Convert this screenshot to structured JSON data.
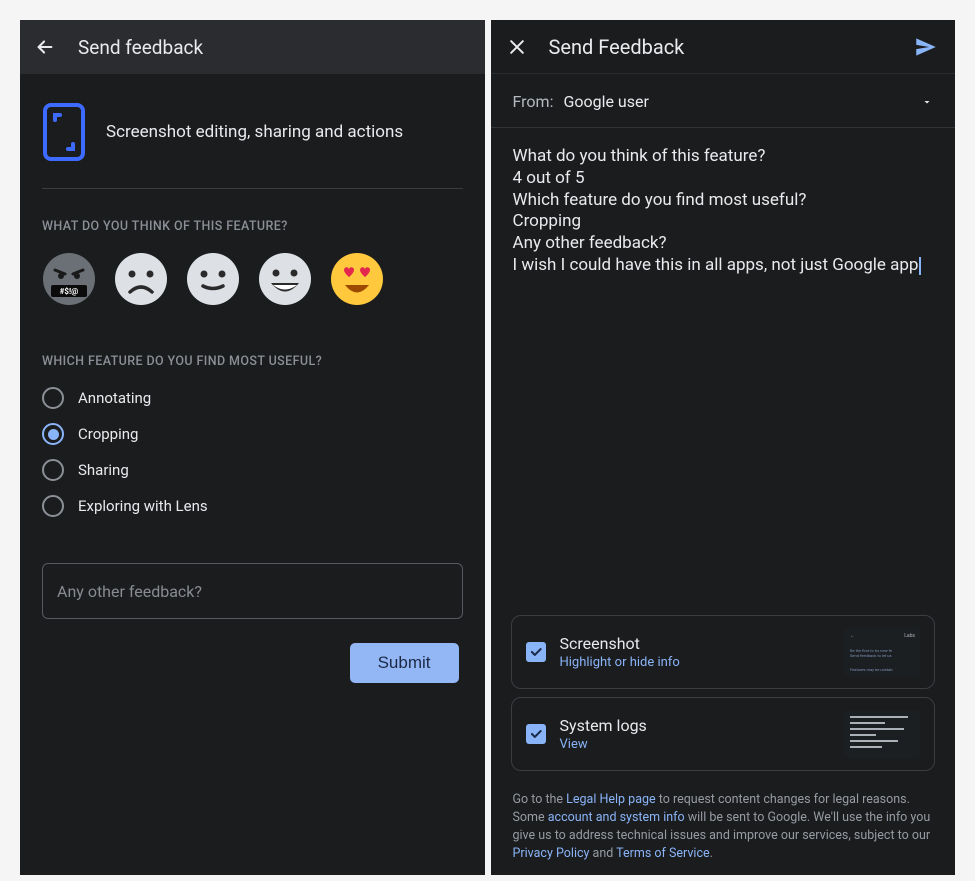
{
  "left": {
    "appbar_title": "Send feedback",
    "feature_title": "Screenshot editing, sharing and actions",
    "q1_label": "WHAT DO YOU THINK OF THIS FEATURE?",
    "q2_label": "WHICH FEATURE DO YOU FIND MOST USEFUL?",
    "options": {
      "0": {
        "label": "Annotating"
      },
      "1": {
        "label": "Cropping"
      },
      "2": {
        "label": "Sharing"
      },
      "3": {
        "label": "Exploring with Lens"
      }
    },
    "selected_option_index": 1,
    "textfield_placeholder": "Any other feedback?",
    "submit_label": "Submit"
  },
  "right": {
    "appbar_title": "Send Feedback",
    "from_label": "From:",
    "from_value": "Google user",
    "message": {
      "l0": "What do you think of this feature?",
      "l1": "4 out of 5",
      "l2": "Which feature do you find most useful?",
      "l3": "Cropping",
      "l4": "Any other feedback?",
      "l5": "I wish I could have this in all apps, not just Google app"
    },
    "attach_screenshot_title": "Screenshot",
    "attach_screenshot_sub": "Highlight or hide info",
    "attach_syslogs_title": "System logs",
    "attach_syslogs_sub": "View",
    "thumb_labs_label": "Labs",
    "legal": {
      "t0": "Go to the ",
      "link0": "Legal Help page",
      "t1": " to request content changes for legal reasons.",
      "t2": "Some ",
      "link1": "account and system info",
      "t3": " will be sent to Google. We'll use the info you give us to address technical issues and improve our services, subject to our ",
      "link2": "Privacy Policy",
      "t4": " and ",
      "link3": "Terms of Service",
      "t5": "."
    }
  }
}
